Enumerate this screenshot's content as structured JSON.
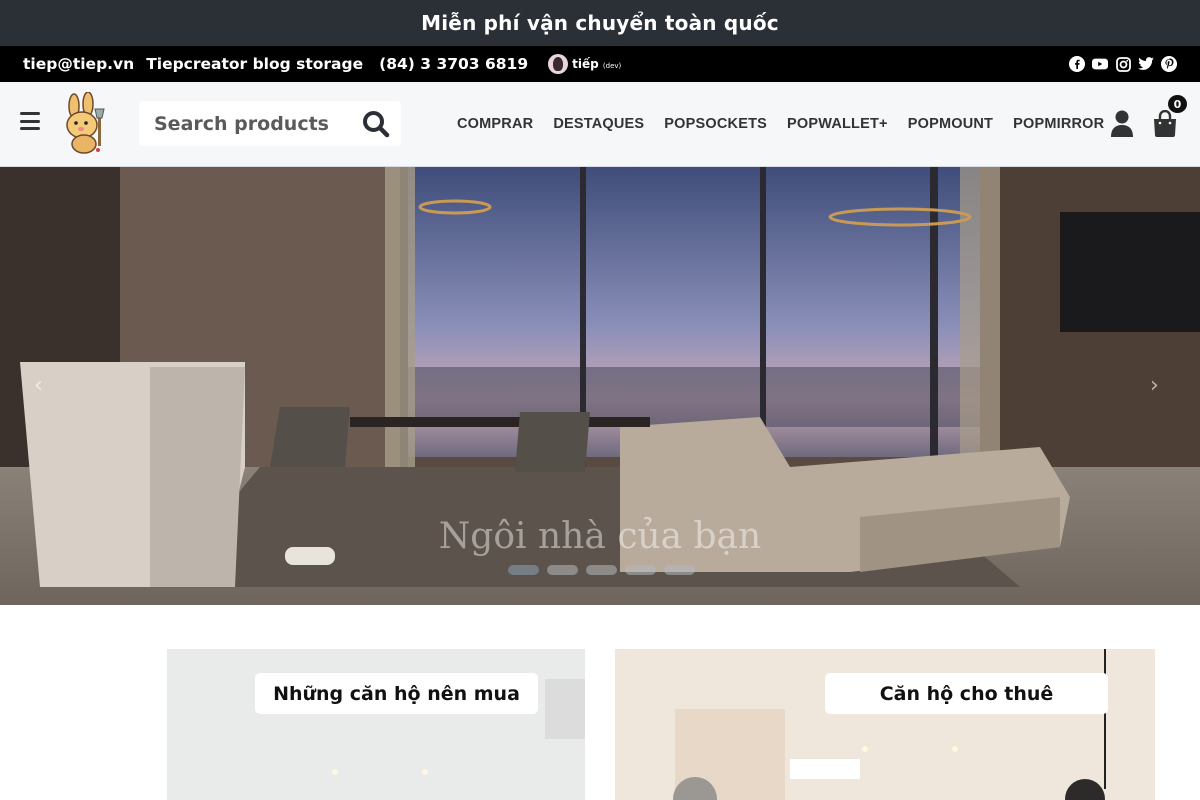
{
  "promo": {
    "text": "Miễn phí vận chuyển toàn quốc"
  },
  "contact": {
    "email": "tiep@tiep.vn",
    "blog": "Tiepcreator blog storage",
    "phone": "(84) 3 3703 6819",
    "logo_text": "tiếp",
    "logo_sub": "(dev)",
    "socials": [
      "facebook-icon",
      "youtube-icon",
      "instagram-icon",
      "twitter-icon",
      "pinterest-icon"
    ]
  },
  "nav": {
    "search_placeholder": "Search products",
    "menu": [
      "COMPRAR",
      "DESTAQUES",
      "POPSOCKETS",
      "POPWALLET+",
      "POPMOUNT",
      "POPMIRROR"
    ],
    "cart_count": "0"
  },
  "hero": {
    "caption": "Ngôi nhà của bạn",
    "prev": "‹",
    "next": "›",
    "slides": 5,
    "active_slide": 1
  },
  "cards": [
    {
      "label": "Những căn hộ nên mua"
    },
    {
      "label": "Căn hộ cho thuê"
    }
  ],
  "colors": {
    "promo_bg": "#2b2f36",
    "contact_bg": "#000000",
    "nav_bg": "#f6f7f9"
  }
}
